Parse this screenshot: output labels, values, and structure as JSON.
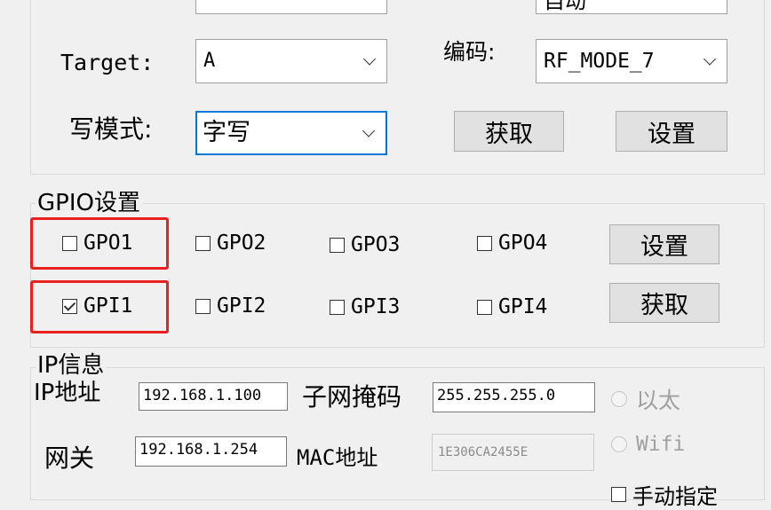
{
  "top_section": {
    "top_combo_value": "",
    "top_right_combo_value": "自动",
    "target_label": "Target:",
    "target_value": "A",
    "encoding_label": "编码:",
    "encoding_value": "RF_MODE_7",
    "write_mode_label": "写模式:",
    "write_mode_value": "字写",
    "get_button": "获取",
    "set_button": "设置"
  },
  "gpio": {
    "title": "GPIO设置",
    "outputs": [
      {
        "label": "GPO1",
        "checked": false
      },
      {
        "label": "GPO2",
        "checked": false
      },
      {
        "label": "GPO3",
        "checked": false
      },
      {
        "label": "GPO4",
        "checked": false
      }
    ],
    "inputs": [
      {
        "label": "GPI1",
        "checked": true
      },
      {
        "label": "GPI2",
        "checked": false
      },
      {
        "label": "GPI3",
        "checked": false
      },
      {
        "label": "GPI4",
        "checked": false
      }
    ],
    "set_button": "设置",
    "get_button": "获取",
    "highlight_color": "#e8211e"
  },
  "ip_info": {
    "title": "IP信息",
    "ip_label": "IP地址",
    "ip_value": "192.168.1.100",
    "subnet_label": "子网掩码",
    "subnet_value": "255.255.255.0",
    "gateway_label": "网关",
    "gateway_value": "192.168.1.254",
    "mac_label": "MAC地址",
    "mac_value": "1E306CA2455E",
    "ethernet_label": "以太",
    "wifi_label": "Wifi",
    "manual_label": "手动指定"
  },
  "colors": {
    "focus_border": "#0078d7",
    "window_bg": "#f0f0f0"
  }
}
